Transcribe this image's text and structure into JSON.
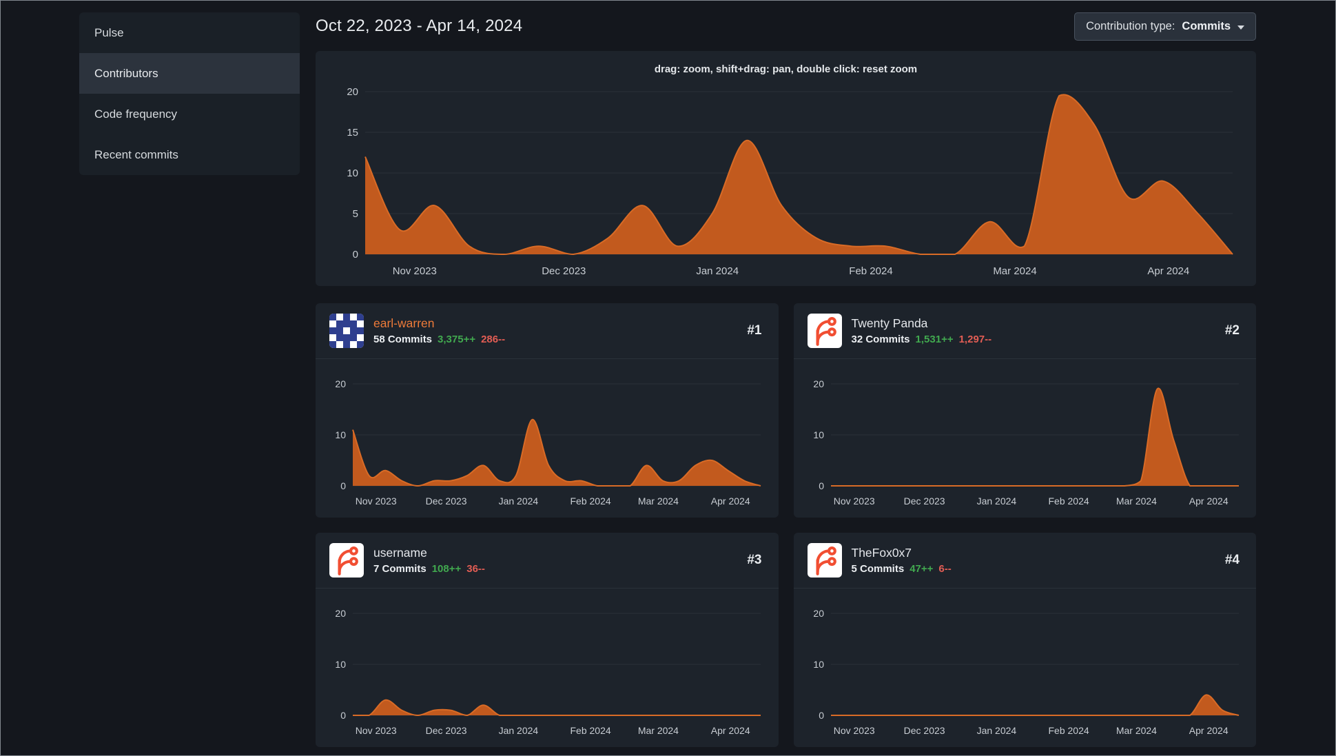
{
  "sidebar": {
    "items": [
      {
        "label": "Pulse",
        "active": false
      },
      {
        "label": "Contributors",
        "active": true
      },
      {
        "label": "Code frequency",
        "active": false
      },
      {
        "label": "Recent commits",
        "active": false
      }
    ]
  },
  "header": {
    "date_range": "Oct 22, 2023 - Apr 14, 2024",
    "contribution_type": {
      "label": "Contribution type:",
      "value": "Commits"
    }
  },
  "main_chart": {
    "hint": "drag: zoom, shift+drag: pan, double click: reset zoom"
  },
  "chart_data": [
    {
      "id": "all",
      "type": "area",
      "title": "All contributors - commits per week",
      "x_start": "2023-10-22",
      "x_end": "2024-04-14",
      "x_step": "weekly",
      "x_tick_labels": [
        "Nov 2023",
        "Dec 2023",
        "Jan 2024",
        "Feb 2024",
        "Mar 2024",
        "Apr 2024"
      ],
      "ylim": [
        0,
        20
      ],
      "yticks": [
        0,
        5,
        10,
        15,
        20
      ],
      "values": [
        12,
        3,
        6,
        1,
        0,
        1,
        0,
        2,
        6,
        1,
        5,
        14,
        6,
        2,
        1,
        1,
        0,
        0,
        4,
        1,
        19.5,
        16,
        7,
        9,
        5,
        0
      ],
      "grid": "horizontal",
      "legend": "none"
    },
    {
      "id": "earl-warren",
      "type": "area",
      "title": "earl-warren - commits per week",
      "x_start": "2023-10-22",
      "x_end": "2024-04-14",
      "x_step": "weekly",
      "x_tick_labels": [
        "Nov 2023",
        "Dec 2023",
        "Jan 2024",
        "Feb 2024",
        "Mar 2024",
        "Apr 2024"
      ],
      "ylim": [
        0,
        20
      ],
      "yticks": [
        0,
        10,
        20
      ],
      "values": [
        11,
        2,
        3,
        1,
        0,
        1,
        1,
        2,
        4,
        1,
        2,
        13,
        4,
        1,
        1,
        0,
        0,
        0,
        4,
        1,
        1,
        4,
        5,
        3,
        1,
        0
      ],
      "grid": "horizontal",
      "legend": "none"
    },
    {
      "id": "twenty-panda",
      "type": "area",
      "title": "Twenty Panda - commits per week",
      "x_start": "2023-10-22",
      "x_end": "2024-04-14",
      "x_step": "weekly",
      "x_tick_labels": [
        "Nov 2023",
        "Dec 2023",
        "Jan 2024",
        "Feb 2024",
        "Mar 2024",
        "Apr 2024"
      ],
      "ylim": [
        0,
        20
      ],
      "yticks": [
        0,
        10,
        20
      ],
      "values": [
        0,
        0,
        0,
        0,
        0,
        0,
        0,
        0,
        0,
        0,
        0,
        0,
        0,
        0,
        0,
        0,
        0,
        0,
        0,
        1,
        19,
        9,
        0,
        0,
        0,
        0
      ],
      "grid": "horizontal",
      "legend": "none"
    },
    {
      "id": "username",
      "type": "area",
      "title": "username - commits per week",
      "x_start": "2023-10-22",
      "x_end": "2024-04-14",
      "x_step": "weekly",
      "x_tick_labels": [
        "Nov 2023",
        "Dec 2023",
        "Jan 2024",
        "Feb 2024",
        "Mar 2024",
        "Apr 2024"
      ],
      "ylim": [
        0,
        20
      ],
      "yticks": [
        0,
        10,
        20
      ],
      "values": [
        0,
        0,
        3,
        1,
        0,
        1,
        1,
        0,
        2,
        0,
        0,
        0,
        0,
        0,
        0,
        0,
        0,
        0,
        0,
        0,
        0,
        0,
        0,
        0,
        0,
        0
      ],
      "grid": "horizontal",
      "legend": "none"
    },
    {
      "id": "thefox0x7",
      "type": "area",
      "title": "TheFox0x7 - commits per week",
      "x_start": "2023-10-22",
      "x_end": "2024-04-14",
      "x_step": "weekly",
      "x_tick_labels": [
        "Nov 2023",
        "Dec 2023",
        "Jan 2024",
        "Feb 2024",
        "Mar 2024",
        "Apr 2024"
      ],
      "ylim": [
        0,
        20
      ],
      "yticks": [
        0,
        10,
        20
      ],
      "values": [
        0,
        0,
        0,
        0,
        0,
        0,
        0,
        0,
        0,
        0,
        0,
        0,
        0,
        0,
        0,
        0,
        0,
        0,
        0,
        0,
        0,
        0,
        0,
        4,
        1,
        0
      ],
      "grid": "horizontal",
      "legend": "none"
    }
  ],
  "contributors": [
    {
      "rank": "#1",
      "name": "earl-warren",
      "name_color": "#ee7b39",
      "avatar": "identicon",
      "chart_id": "earl-warren",
      "commits_label": "58 Commits",
      "additions": "3,375++",
      "deletions": "286--"
    },
    {
      "rank": "#2",
      "name": "Twenty Panda",
      "name_color": "#e4e7eb",
      "avatar": "forgejo",
      "chart_id": "twenty-panda",
      "commits_label": "32 Commits",
      "additions": "1,531++",
      "deletions": "1,297--"
    },
    {
      "rank": "#3",
      "name": "username",
      "name_color": "#e4e7eb",
      "avatar": "forgejo",
      "chart_id": "username",
      "commits_label": "7 Commits",
      "additions": "108++",
      "deletions": "36--"
    },
    {
      "rank": "#4",
      "name": "TheFox0x7",
      "name_color": "#e4e7eb",
      "avatar": "forgejo",
      "chart_id": "thefox0x7",
      "commits_label": "5 Commits",
      "additions": "47++",
      "deletions": "6--"
    }
  ],
  "avatars": {
    "identicon": {
      "pattern": [
        "BWBWB",
        "WBBBW",
        "BBWBB",
        "WBBBW",
        "BWBWB"
      ],
      "fg": "#2f3f8f",
      "bg": "#ffffff"
    },
    "forgejo": {
      "color": "#f14e32",
      "bg": "#ffffff"
    }
  },
  "colors": {
    "page_bg": "#14171d",
    "card_bg": "#1d232b",
    "menu_active_bg": "#2c333d",
    "area_fill": "#c25a1e",
    "area_stroke": "#d96b26",
    "grid_line": "#2a3039",
    "axis_text": "#c8cdd3",
    "additions_green": "#41a94f",
    "deletions_red": "#e25d54",
    "link_orange": "#ee7b39"
  }
}
